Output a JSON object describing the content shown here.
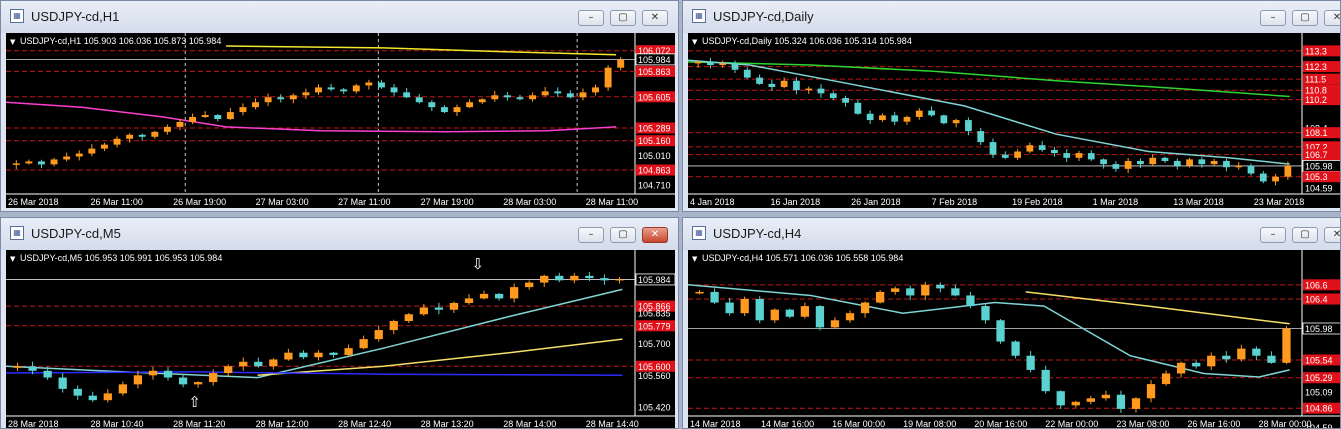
{
  "colors": {
    "bull": "#ff9a1e",
    "bear": "#5ad2cf",
    "level": "#c41616",
    "ma_fast": "#7fd4d4",
    "current": "#d9d9d9",
    "tag": "#e1111a"
  },
  "windows": [
    {
      "title": "USDJPY-cd,H1",
      "info": "USDJPY-cd,H1  105.903 106.036 105.873 105.984",
      "window_buttons": {
        "minimize": "–",
        "restore": "▢",
        "close": "✕"
      },
      "close_active": false,
      "price_axis": {
        "max": 106.15,
        "min": 104.62
      },
      "labels": [
        {
          "text": "106.072",
          "value": 106.072,
          "tag": true
        },
        {
          "text": "105.984",
          "value": 105.984,
          "tag": false,
          "current": true
        },
        {
          "text": "105.863",
          "value": 105.863,
          "tag": true
        },
        {
          "text": "105.605",
          "value": 105.605,
          "tag": true
        },
        {
          "text": "105.289",
          "value": 105.289,
          "tag": true
        },
        {
          "text": "105.160",
          "value": 105.16,
          "tag": true
        },
        {
          "text": "105.010",
          "value": 105.01,
          "tag": false
        },
        {
          "text": "104.863",
          "value": 104.863,
          "tag": true
        },
        {
          "text": "104.710",
          "value": 104.71,
          "tag": false
        }
      ],
      "times": [
        "26 Mar 2018",
        "26 Mar 11:00",
        "26 Mar 19:00",
        "27 Mar 03:00",
        "27 Mar 11:00",
        "27 Mar 19:00",
        "28 Mar 03:00",
        "28 Mar 11:00"
      ],
      "separators": [
        0.285,
        0.592,
        0.908
      ],
      "seed": 11,
      "closes": [
        104.93,
        104.95,
        104.92,
        104.97,
        105.0,
        105.03,
        105.08,
        105.12,
        105.18,
        105.22,
        105.2,
        105.25,
        105.3,
        105.35,
        105.4,
        105.42,
        105.38,
        105.45,
        105.5,
        105.55,
        105.6,
        105.58,
        105.62,
        105.65,
        105.7,
        105.68,
        105.66,
        105.72,
        105.75,
        105.7,
        105.65,
        105.6,
        105.55,
        105.5,
        105.45,
        105.5,
        105.55,
        105.58,
        105.62,
        105.6,
        105.58,
        105.62,
        105.66,
        105.64,
        105.6,
        105.65,
        105.7,
        105.9,
        105.98
      ],
      "lines": [
        {
          "color": "#ff3fd0",
          "points": [
            [
              0,
              105.55
            ],
            [
              0.12,
              105.5
            ],
            [
              0.25,
              105.4
            ],
            [
              0.35,
              105.3
            ],
            [
              0.5,
              105.26
            ],
            [
              0.7,
              105.25
            ],
            [
              0.86,
              105.26
            ],
            [
              0.97,
              105.3
            ]
          ]
        },
        {
          "color": "#f2e82c",
          "points": [
            [
              0.35,
              106.12
            ],
            [
              0.6,
              106.1
            ],
            [
              0.8,
              106.06
            ],
            [
              0.97,
              106.03
            ]
          ]
        }
      ]
    },
    {
      "title": "USDJPY-cd,Daily",
      "info": "USDJPY-cd,Daily  105.324 106.036 105.314 105.984",
      "window_buttons": {
        "minimize": "–",
        "restore": "▢",
        "close": "✕"
      },
      "close_active": false,
      "price_axis": {
        "max": 113.8,
        "min": 104.2
      },
      "labels": [
        {
          "text": "113.3",
          "value": 113.3,
          "tag": true
        },
        {
          "text": "112.3",
          "value": 112.3,
          "tag": true
        },
        {
          "text": "111.5",
          "value": 111.5,
          "tag": true
        },
        {
          "text": "110.8",
          "value": 110.8,
          "tag": true
        },
        {
          "text": "110.2",
          "value": 110.2,
          "tag": true
        },
        {
          "text": "108.4",
          "value": 108.4,
          "tag": false
        },
        {
          "text": "108.1",
          "value": 108.1,
          "tag": true
        },
        {
          "text": "107.2",
          "value": 107.2,
          "tag": true
        },
        {
          "text": "106.7",
          "value": 106.7,
          "tag": true
        },
        {
          "text": "105.98",
          "value": 105.984,
          "tag": false,
          "current": true
        },
        {
          "text": "105.3",
          "value": 105.3,
          "tag": true
        },
        {
          "text": "104.59",
          "value": 104.59,
          "tag": false
        }
      ],
      "times": [
        "4 Jan 2018",
        "16 Jan 2018",
        "26 Jan 2018",
        "7 Feb 2018",
        "19 Feb 2018",
        "1 Mar 2018",
        "13 Mar 2018",
        "23 Mar 2018"
      ],
      "separators": [],
      "seed": 23,
      "closes": [
        112.6,
        112.4,
        112.5,
        112.1,
        111.6,
        111.2,
        111.0,
        111.4,
        110.8,
        110.9,
        110.6,
        110.3,
        110.0,
        109.3,
        108.9,
        109.2,
        108.8,
        109.1,
        109.5,
        109.2,
        108.7,
        108.9,
        108.2,
        107.5,
        106.7,
        106.5,
        106.9,
        107.3,
        107.0,
        106.8,
        106.5,
        106.8,
        106.4,
        106.1,
        105.8,
        106.3,
        106.1,
        106.5,
        106.3,
        106.0,
        106.4,
        106.1,
        106.3,
        105.9,
        106.0,
        105.5,
        105.0,
        105.3,
        105.98
      ],
      "lines": [
        {
          "color": "#2fd52f",
          "points": [
            [
              0,
              112.6
            ],
            [
              0.2,
              112.4
            ],
            [
              0.4,
              112.0
            ],
            [
              0.6,
              111.4
            ],
            [
              0.8,
              110.9
            ],
            [
              0.98,
              110.4
            ]
          ]
        },
        {
          "color": "#7fd4d4",
          "points": [
            [
              0,
              112.7
            ],
            [
              0.1,
              112.4
            ],
            [
              0.25,
              111.3
            ],
            [
              0.45,
              109.8
            ],
            [
              0.6,
              108.0
            ],
            [
              0.75,
              106.9
            ],
            [
              0.88,
              106.5
            ],
            [
              0.98,
              106.1
            ]
          ]
        }
      ]
    },
    {
      "title": "USDJPY-cd,M5",
      "info": "USDJPY-cd,M5  105.953 105.991 105.953 105.984",
      "window_buttons": {
        "minimize": "–",
        "restore": "▢",
        "close": "✕"
      },
      "close_active": true,
      "price_axis": {
        "max": 106.07,
        "min": 105.38
      },
      "labels": [
        {
          "text": "105.984",
          "value": 105.984,
          "tag": false,
          "current": true
        },
        {
          "text": "105.866",
          "value": 105.866,
          "tag": true
        },
        {
          "text": "105.835",
          "value": 105.835,
          "tag": false
        },
        {
          "text": "105.779",
          "value": 105.779,
          "tag": true
        },
        {
          "text": "105.700",
          "value": 105.7,
          "tag": false
        },
        {
          "text": "105.600",
          "value": 105.6,
          "tag": true
        },
        {
          "text": "105.560",
          "value": 105.56,
          "tag": false
        },
        {
          "text": "105.420",
          "value": 105.42,
          "tag": false
        }
      ],
      "times": [
        "28 Mar 2018",
        "28 Mar 10:40",
        "28 Mar 11:20",
        "28 Mar 12:00",
        "28 Mar 12:40",
        "28 Mar 13:20",
        "28 Mar 14:00",
        "28 Mar 14:40"
      ],
      "separators": [],
      "seed": 37,
      "closes": [
        105.6,
        105.58,
        105.55,
        105.5,
        105.47,
        105.45,
        105.48,
        105.52,
        105.56,
        105.58,
        105.55,
        105.52,
        105.53,
        105.57,
        105.6,
        105.62,
        105.6,
        105.63,
        105.66,
        105.64,
        105.66,
        105.65,
        105.68,
        105.72,
        105.76,
        105.8,
        105.83,
        105.86,
        105.85,
        105.88,
        105.9,
        105.92,
        105.9,
        105.95,
        105.97,
        106.0,
        105.98,
        106.0,
        105.99,
        105.98,
        105.984
      ],
      "lines": [
        {
          "color": "#7fd4d4",
          "points": [
            [
              0,
              105.6
            ],
            [
              0.15,
              105.58
            ],
            [
              0.4,
              105.55
            ],
            [
              0.6,
              105.68
            ],
            [
              0.8,
              105.82
            ],
            [
              0.98,
              105.94
            ]
          ]
        },
        {
          "color": "#f5e067",
          "points": [
            [
              0.4,
              105.56
            ],
            [
              0.6,
              105.6
            ],
            [
              0.8,
              105.66
            ],
            [
              0.98,
              105.72
            ]
          ]
        },
        {
          "color": "#2b2bff",
          "points": [
            [
              0,
              105.57
            ],
            [
              0.3,
              105.575
            ],
            [
              0.6,
              105.565
            ],
            [
              0.98,
              105.56
            ]
          ]
        }
      ],
      "arrows": [
        {
          "symbol": "⇩",
          "x": 0.75,
          "value": 106.03
        },
        {
          "symbol": "⇧",
          "x": 0.3,
          "value": 105.42
        }
      ]
    },
    {
      "title": "USDJPY-cd,H4",
      "info": "USDJPY-cd,H4  105.571 106.036 105.558 105.984",
      "window_buttons": {
        "minimize": "–",
        "restore": "▢",
        "close": "✕"
      },
      "close_active": false,
      "price_axis": {
        "max": 106.95,
        "min": 104.75
      },
      "labels": [
        {
          "text": "106.6",
          "value": 106.6,
          "tag": true
        },
        {
          "text": "106.4",
          "value": 106.4,
          "tag": true
        },
        {
          "text": "105.98",
          "value": 105.984,
          "tag": false,
          "current": true
        },
        {
          "text": "105.54",
          "value": 105.54,
          "tag": true
        },
        {
          "text": "105.29",
          "value": 105.29,
          "tag": true
        },
        {
          "text": "105.09",
          "value": 105.09,
          "tag": false
        },
        {
          "text": "104.86",
          "value": 104.86,
          "tag": true
        },
        {
          "text": "104.59",
          "value": 104.59,
          "tag": false
        }
      ],
      "times": [
        "14 Mar 2018",
        "14 Mar 16:00",
        "16 Mar 00:00",
        "19 Mar 08:00",
        "20 Mar 16:00",
        "22 Mar 00:00",
        "23 Mar 08:00",
        "26 Mar 16:00",
        "28 Mar 00:00"
      ],
      "separators": [],
      "seed": 53,
      "closes": [
        106.5,
        106.35,
        106.2,
        106.4,
        106.1,
        106.25,
        106.15,
        106.3,
        106.0,
        106.1,
        106.2,
        106.35,
        106.5,
        106.55,
        106.45,
        106.6,
        106.55,
        106.45,
        106.3,
        106.1,
        105.8,
        105.6,
        105.4,
        105.1,
        104.9,
        104.95,
        105.0,
        105.05,
        104.85,
        105.0,
        105.2,
        105.35,
        105.5,
        105.45,
        105.6,
        105.55,
        105.7,
        105.6,
        105.5,
        105.984
      ],
      "lines": [
        {
          "color": "#7fd4d4",
          "points": [
            [
              0,
              106.6
            ],
            [
              0.2,
              106.45
            ],
            [
              0.35,
              106.2
            ],
            [
              0.5,
              106.35
            ],
            [
              0.58,
              106.3
            ],
            [
              0.72,
              105.6
            ],
            [
              0.84,
              105.35
            ],
            [
              0.93,
              105.3
            ],
            [
              0.98,
              105.4
            ]
          ]
        },
        {
          "color": "#f5e067",
          "points": [
            [
              0.55,
              106.5
            ],
            [
              0.75,
              106.3
            ],
            [
              0.98,
              106.05
            ]
          ]
        }
      ]
    }
  ]
}
